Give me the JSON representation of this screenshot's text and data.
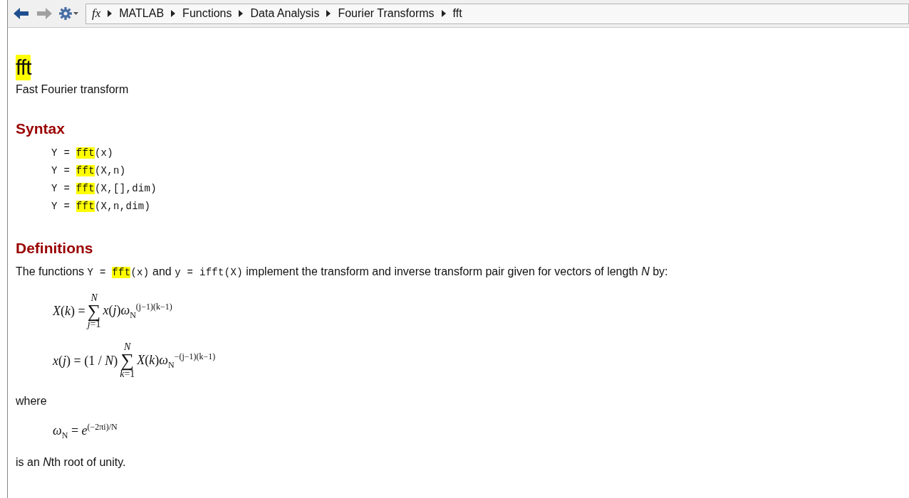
{
  "toolbar": {
    "back": {
      "disabled": false
    },
    "forward": {
      "disabled": true
    },
    "function_marker": "fx",
    "breadcrumbs": [
      "MATLAB",
      "Functions",
      "Data Analysis",
      "Fourier Transforms",
      "fft"
    ]
  },
  "page": {
    "title": "fft",
    "summary": "Fast Fourier transform",
    "sections": [
      {
        "kind": "syntax",
        "heading": "Syntax",
        "lines": [
          {
            "segments": [
              {
                "text": "Y = ",
                "highlighted": false
              },
              {
                "text": "fft",
                "highlighted": true
              },
              {
                "text": "(x)",
                "highlighted": false
              }
            ]
          },
          {
            "segments": [
              {
                "text": "Y = ",
                "highlighted": false
              },
              {
                "text": "fft",
                "highlighted": true
              },
              {
                "text": "(X,n)",
                "highlighted": false
              }
            ]
          },
          {
            "segments": [
              {
                "text": "Y = ",
                "highlighted": false
              },
              {
                "text": "fft",
                "highlighted": true
              },
              {
                "text": "(X,[],dim)",
                "highlighted": false
              }
            ]
          },
          {
            "segments": [
              {
                "text": "Y = ",
                "highlighted": false
              },
              {
                "text": "fft",
                "highlighted": true
              },
              {
                "text": "(X,n,dim)",
                "highlighted": false
              }
            ]
          }
        ]
      },
      {
        "kind": "definitions",
        "heading": "Definitions",
        "blocks": [
          {
            "kind": "paragraph",
            "segments": [
              {
                "kind": "text",
                "text": "The functions ",
                "highlighted": false
              },
              {
                "kind": "code",
                "text": "Y = ",
                "highlighted": false
              },
              {
                "kind": "code",
                "text": "fft",
                "highlighted": true
              },
              {
                "kind": "code",
                "text": "(x)",
                "highlighted": false
              },
              {
                "kind": "text",
                "text": " and ",
                "highlighted": false
              },
              {
                "kind": "code",
                "text": "y = ifft(X)",
                "highlighted": false
              },
              {
                "kind": "text",
                "text": " implement the transform and inverse transform pair given for vectors of length ",
                "highlighted": false
              },
              {
                "kind": "variable",
                "text": "N",
                "highlighted": false
              },
              {
                "kind": "text",
                "text": " by:",
                "highlighted": false
              }
            ]
          },
          {
            "kind": "equation",
            "lhs": "*X*(*k*) =",
            "sum": {
              "upper": "*N*",
              "symbol": "∑",
              "lower": "*j*=1"
            },
            "rhs": "*x*(*j*)*ω*$_{N}$$^{(j−1)(k−1)}$"
          },
          {
            "kind": "equation",
            "lhs": "*x*(*j*) = (1 / *N*)",
            "sum": {
              "upper": "*N*",
              "symbol": "∑",
              "lower": "*k*=1"
            },
            "rhs": "*X*(*k*)*ω*$_{N}$$^{−(j−1)(k−1)}$"
          },
          {
            "kind": "paragraph",
            "segments": [
              {
                "kind": "text",
                "text": "where",
                "highlighted": false
              }
            ]
          },
          {
            "kind": "equation",
            "lhs": "*ω*$_{N}$ = *e*$^{(−2πi)/N}$"
          },
          {
            "kind": "paragraph",
            "segments": [
              {
                "kind": "text",
                "text": "is an ",
                "highlighted": false
              },
              {
                "kind": "variable",
                "text": "N",
                "highlighted": false
              },
              {
                "kind": "text",
                "text": "th root of unity.",
                "highlighted": false
              }
            ]
          }
        ]
      }
    ]
  }
}
